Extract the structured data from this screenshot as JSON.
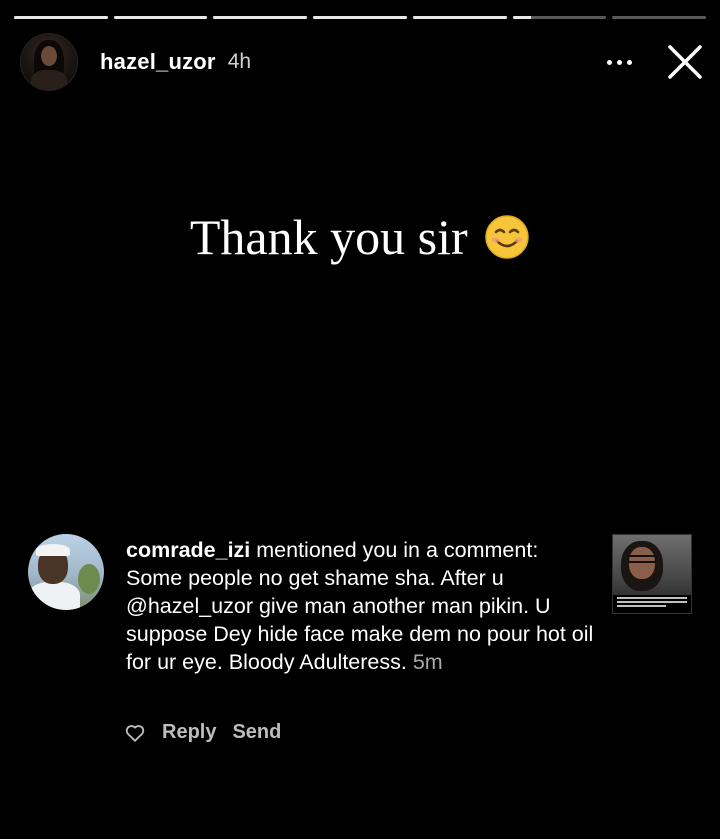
{
  "progress": [
    1,
    1,
    1,
    1,
    1,
    0.2,
    0
  ],
  "header": {
    "username": "hazel_uzor",
    "time": "4h",
    "more_icon": "more-horizontal-icon",
    "close_icon": "close-icon"
  },
  "story": {
    "text": "Thank you sir",
    "emoji": "smiling-face-icon"
  },
  "notification": {
    "username": "comrade_izi",
    "message": " mentioned you in a comment: Some people no get shame sha. After u @hazel_uzor give man another man pikin. U suppose Dey hide face make dem no pour hot oil for ur eye. Bloody Adulteress. ",
    "time_ago": "5m",
    "reply_label": "Reply",
    "send_label": "Send",
    "like_icon": "heart-outline-icon"
  },
  "colors": {
    "background": "#000000",
    "text": "#ffffff",
    "muted": "#a8a8a8",
    "emoji": "#f7c53a"
  }
}
